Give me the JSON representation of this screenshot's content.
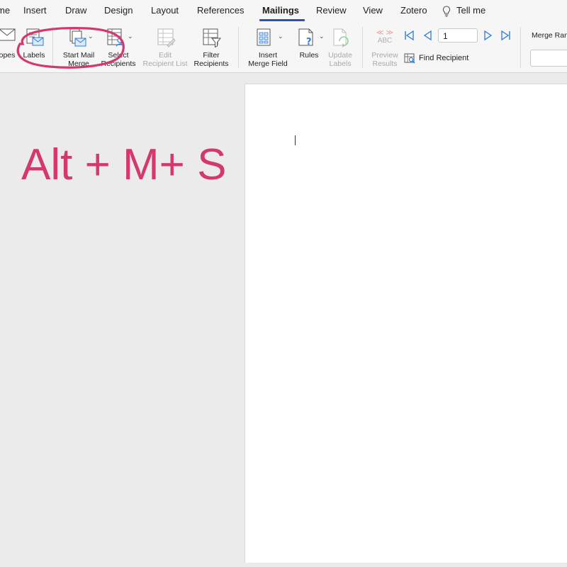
{
  "tabs": [
    {
      "label": "me",
      "active": false
    },
    {
      "label": "Insert",
      "active": false
    },
    {
      "label": "Draw",
      "active": false
    },
    {
      "label": "Design",
      "active": false
    },
    {
      "label": "Layout",
      "active": false
    },
    {
      "label": "References",
      "active": false
    },
    {
      "label": "Mailings",
      "active": true
    },
    {
      "label": "Review",
      "active": false
    },
    {
      "label": "View",
      "active": false
    },
    {
      "label": "Zotero",
      "active": false
    }
  ],
  "tell_me": "Tell me",
  "ribbon": {
    "envelopes": "opes",
    "labels": "Labels",
    "start_mail_merge": [
      "Start Mail",
      "Merge"
    ],
    "select_recipients": [
      "Select",
      "Recipients"
    ],
    "edit_recipient_list": [
      "Edit",
      "Recipient List"
    ],
    "filter_recipients": [
      "Filter",
      "Recipients"
    ],
    "insert_merge_field": [
      "Insert",
      "Merge Field"
    ],
    "rules": "Rules",
    "update_labels": [
      "Update",
      "Labels"
    ],
    "preview_results": [
      "Preview",
      "Results"
    ],
    "preview_abc": "ABC",
    "record_number": "1",
    "find_recipient": "Find Recipient",
    "merge_range_label": "Merge Ran"
  },
  "overlay": {
    "shortcut_text": "Alt + M+ S",
    "accent_color": "#d3386f"
  },
  "colors": {
    "tab_underline": "#2b579a",
    "nav_arrow": "#2f7ad6"
  }
}
